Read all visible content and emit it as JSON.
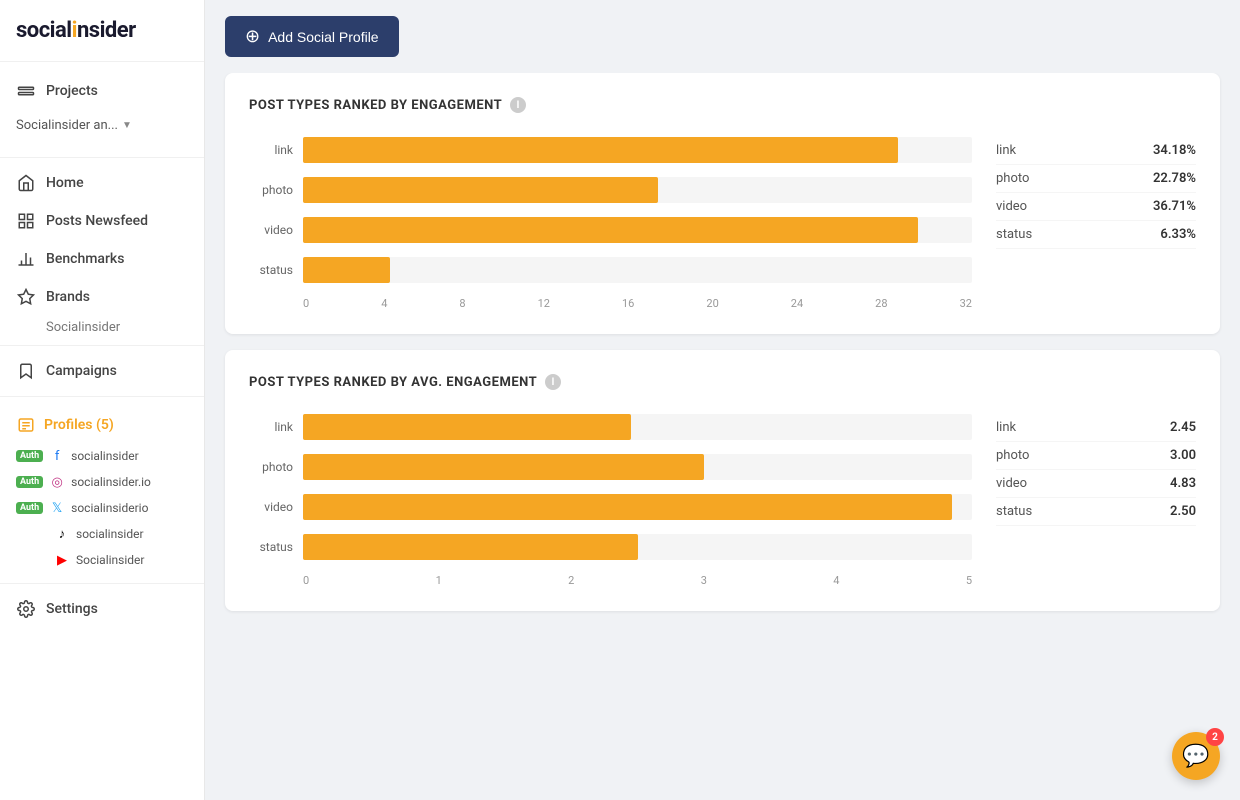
{
  "app": {
    "name": "socialinsider",
    "logo_dot": "n"
  },
  "sidebar": {
    "project_label": "Socialinsider an...",
    "nav_items": [
      {
        "id": "projects",
        "label": "Projects",
        "icon": "⊞"
      },
      {
        "id": "home",
        "label": "Home",
        "icon": "⌂"
      },
      {
        "id": "posts-newsfeed",
        "label": "Posts Newsfeed",
        "icon": "⊟"
      },
      {
        "id": "benchmarks",
        "label": "Benchmarks",
        "icon": "📊"
      },
      {
        "id": "brands",
        "label": "Brands",
        "icon": "✦"
      }
    ],
    "brand_name": "Socialinsider",
    "campaigns_label": "Campaigns",
    "profiles_label": "Profiles (5)",
    "profiles_icon": "▦",
    "profiles": [
      {
        "auth": true,
        "platform": "fb",
        "name": "socialinsider",
        "icon": "f"
      },
      {
        "auth": true,
        "platform": "ig",
        "name": "socialinsider.io",
        "icon": "◎"
      },
      {
        "auth": true,
        "platform": "tw",
        "name": "socialinsiderio",
        "icon": "𝕏"
      },
      {
        "auth": false,
        "platform": "tk",
        "name": "socialinsider",
        "icon": "♪"
      },
      {
        "auth": false,
        "platform": "yt",
        "name": "Socialinsider",
        "icon": "▶"
      }
    ],
    "settings_label": "Settings"
  },
  "header": {
    "add_profile_label": "Add Social Profile"
  },
  "chart1": {
    "title": "POST TYPES RANKED BY ENGAGEMENT",
    "bars": [
      {
        "label": "link",
        "value": 28.5,
        "max": 32
      },
      {
        "label": "photo",
        "value": 17.0,
        "max": 32
      },
      {
        "label": "video",
        "value": 29.5,
        "max": 32
      },
      {
        "label": "status",
        "value": 4.2,
        "max": 32
      }
    ],
    "axis_ticks": [
      "0",
      "4",
      "8",
      "12",
      "16",
      "20",
      "24",
      "28",
      "32"
    ],
    "legend": [
      {
        "label": "link",
        "value": "34.18%"
      },
      {
        "label": "photo",
        "value": "22.78%"
      },
      {
        "label": "video",
        "value": "36.71%"
      },
      {
        "label": "status",
        "value": "6.33%"
      }
    ]
  },
  "chart2": {
    "title": "POST TYPES RANKED BY AVG. ENGAGEMENT",
    "bars": [
      {
        "label": "link",
        "value": 2.45,
        "max": 5
      },
      {
        "label": "photo",
        "value": 3.0,
        "max": 5
      },
      {
        "label": "video",
        "value": 4.83,
        "max": 5
      },
      {
        "label": "status",
        "value": 2.5,
        "max": 5
      }
    ],
    "axis_ticks": [
      "0",
      "1",
      "2",
      "3",
      "4",
      "5"
    ],
    "legend": [
      {
        "label": "link",
        "value": "2.45"
      },
      {
        "label": "photo",
        "value": "3.00"
      },
      {
        "label": "video",
        "value": "4.83"
      },
      {
        "label": "status",
        "value": "2.50"
      }
    ]
  },
  "chat_widget": {
    "badge_count": "2"
  }
}
